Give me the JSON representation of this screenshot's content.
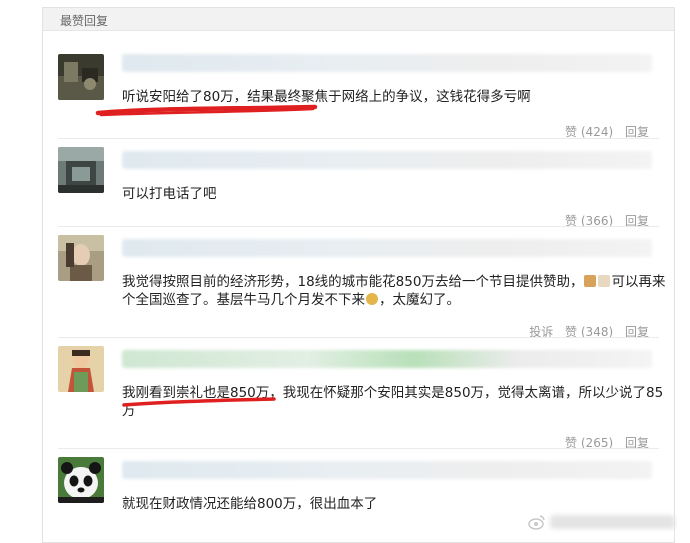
{
  "panel": {
    "title": "最赞回复"
  },
  "replies": [
    {
      "text": "听说安阳给了80万，结果最终聚焦于网络上的争议，这钱花得多亏啊",
      "like_label": "赞",
      "like_count": "(424)",
      "reply_label": "回复"
    },
    {
      "text": "可以打电话了吧",
      "like_label": "赞",
      "like_count": "(366)",
      "reply_label": "回复"
    },
    {
      "text_line1": "我觉得按照目前的经济形势，18线的城市能花850万去给一个节目提供赞助，",
      "text_line1_tail": "可以再来",
      "text_line2": "个全国巡查了。基层牛马几个月发不下来",
      "text_line2_tail": "，太魔幻了。",
      "report_label": "投诉",
      "like_label": "赞",
      "like_count": "(348)",
      "reply_label": "回复"
    },
    {
      "text_line1": "我刚看到崇礼也是850万，我现在怀疑那个安阳其实是850万，觉得太离谱，所以少说了85",
      "text_line2": "万",
      "like_label": "赞",
      "like_count": "(265)",
      "reply_label": "回复"
    },
    {
      "text": "就现在财政情况还能给800万，很出血本了"
    }
  ],
  "icons": {
    "emoji_1": "gift-box-emoji",
    "emoji_2": "dog-emoji",
    "emoji_3": "money-bag-emoji"
  },
  "highlight_color": "#e02020"
}
